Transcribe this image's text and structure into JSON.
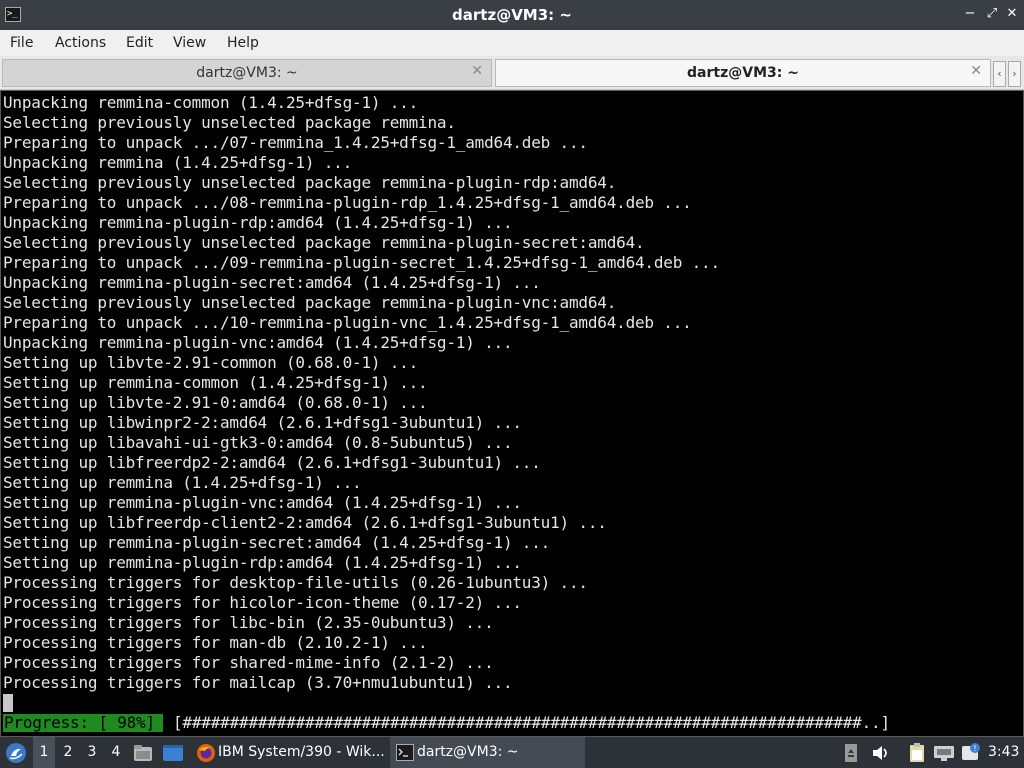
{
  "window": {
    "title": "dartz@VM3: ~",
    "app_icon_glyph": ">_",
    "buttons": {
      "minimize": "−",
      "maximize": "⤢",
      "close": "✕"
    }
  },
  "menu": [
    "File",
    "Actions",
    "Edit",
    "View",
    "Help"
  ],
  "tabs": [
    {
      "label": "dartz@VM3: ~",
      "active": false
    },
    {
      "label": "dartz@VM3: ~",
      "active": true
    }
  ],
  "terminal": {
    "lines": [
      "Unpacking remmina-common (1.4.25+dfsg-1) ...",
      "Selecting previously unselected package remmina.",
      "Preparing to unpack .../07-remmina_1.4.25+dfsg-1_amd64.deb ...",
      "Unpacking remmina (1.4.25+dfsg-1) ...",
      "Selecting previously unselected package remmina-plugin-rdp:amd64.",
      "Preparing to unpack .../08-remmina-plugin-rdp_1.4.25+dfsg-1_amd64.deb ...",
      "Unpacking remmina-plugin-rdp:amd64 (1.4.25+dfsg-1) ...",
      "Selecting previously unselected package remmina-plugin-secret:amd64.",
      "Preparing to unpack .../09-remmina-plugin-secret_1.4.25+dfsg-1_amd64.deb ...",
      "Unpacking remmina-plugin-secret:amd64 (1.4.25+dfsg-1) ...",
      "Selecting previously unselected package remmina-plugin-vnc:amd64.",
      "Preparing to unpack .../10-remmina-plugin-vnc_1.4.25+dfsg-1_amd64.deb ...",
      "Unpacking remmina-plugin-vnc:amd64 (1.4.25+dfsg-1) ...",
      "Setting up libvte-2.91-common (0.68.0-1) ...",
      "Setting up remmina-common (1.4.25+dfsg-1) ...",
      "Setting up libvte-2.91-0:amd64 (0.68.0-1) ...",
      "Setting up libwinpr2-2:amd64 (2.6.1+dfsg1-3ubuntu1) ...",
      "Setting up libavahi-ui-gtk3-0:amd64 (0.8-5ubuntu5) ...",
      "Setting up libfreerdp2-2:amd64 (2.6.1+dfsg1-3ubuntu1) ...",
      "Setting up remmina (1.4.25+dfsg-1) ...",
      "Setting up remmina-plugin-vnc:amd64 (1.4.25+dfsg-1) ...",
      "Setting up libfreerdp-client2-2:amd64 (2.6.1+dfsg1-3ubuntu1) ...",
      "Setting up remmina-plugin-secret:amd64 (1.4.25+dfsg-1) ...",
      "Setting up remmina-plugin-rdp:amd64 (1.4.25+dfsg-1) ...",
      "Processing triggers for desktop-file-utils (0.26-1ubuntu3) ...",
      "Processing triggers for hicolor-icon-theme (0.17-2) ...",
      "Processing triggers for libc-bin (2.35-0ubuntu3) ...",
      "Processing triggers for man-db (2.10.2-1) ...",
      "Processing triggers for shared-mime-info (2.1-2) ...",
      "Processing triggers for mailcap (3.70+nmu1ubuntu1) ..."
    ],
    "progress_label": "Progress: [ 98%]",
    "progress_bar": "[########################################################################..]",
    "progress_percent": 98,
    "colors": {
      "background": "#000000",
      "text": "#e6e6e6",
      "progress_bg": "#1f8a1f"
    }
  },
  "taskbar": {
    "workspaces": [
      "1",
      "2",
      "3",
      "4"
    ],
    "active_workspace": "1",
    "tasks": [
      {
        "label": "IBM System/390 - Wik...",
        "icon": "firefox-icon",
        "active": false
      },
      {
        "label": "dartz@VM3: ~",
        "icon": "terminal-icon",
        "active": true
      }
    ],
    "clock": "3:43"
  }
}
